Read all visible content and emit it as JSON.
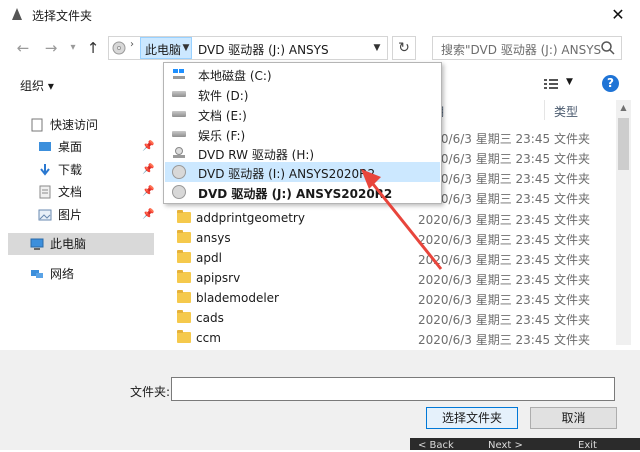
{
  "window": {
    "title": "选择文件夹"
  },
  "address": {
    "crumb": "此电脑",
    "path": "DVD 驱动器 (J:) ANSYS"
  },
  "search": {
    "placeholder": "搜索\"DVD 驱动器 (J:) ANSYS"
  },
  "toolbar": {
    "organize": "组织 ▾"
  },
  "nav": {
    "items": [
      {
        "label": "快速访问",
        "icon": "star-icon"
      },
      {
        "label": "桌面",
        "icon": "desktop-icon",
        "pinned": true
      },
      {
        "label": "下载",
        "icon": "download-icon",
        "pinned": true
      },
      {
        "label": "文档",
        "icon": "document-icon",
        "pinned": true
      },
      {
        "label": "图片",
        "icon": "pictures-icon",
        "pinned": true
      },
      {
        "label": "此电脑",
        "icon": "computer-icon",
        "selected": true
      },
      {
        "label": "网络",
        "icon": "network-icon"
      }
    ]
  },
  "columns": {
    "date": "日期",
    "type": "类型"
  },
  "rows": [
    {
      "name": "",
      "date": "2020/6/3 星期三 23:45",
      "type": "文件夹"
    },
    {
      "name": "",
      "date": "2020/6/3 星期三 23:45",
      "type": "文件夹"
    },
    {
      "name": "",
      "date": "2020/6/3 星期三 23:45",
      "type": "文件夹"
    },
    {
      "name": "",
      "date": "2020/6/3 星期三 23:45",
      "type": "文件夹"
    },
    {
      "name": "addprintgeometry",
      "date": "2020/6/3 星期三 23:45",
      "type": "文件夹"
    },
    {
      "name": "ansys",
      "date": "2020/6/3 星期三 23:45",
      "type": "文件夹"
    },
    {
      "name": "apdl",
      "date": "2020/6/3 星期三 23:45",
      "type": "文件夹"
    },
    {
      "name": "apipsrv",
      "date": "2020/6/3 星期三 23:45",
      "type": "文件夹"
    },
    {
      "name": "blademodeler",
      "date": "2020/6/3 星期三 23:45",
      "type": "文件夹"
    },
    {
      "name": "cads",
      "date": "2020/6/3 星期三 23:45",
      "type": "文件夹"
    },
    {
      "name": "ccm",
      "date": "2020/6/3 星期三 23:45",
      "type": "文件夹"
    }
  ],
  "dropdown": {
    "items": [
      {
        "label": "本地磁盘 (C:)",
        "icon": "windows-drive-icon"
      },
      {
        "label": "软件 (D:)",
        "icon": "drive-icon"
      },
      {
        "label": "文档 (E:)",
        "icon": "drive-icon"
      },
      {
        "label": "娱乐 (F:)",
        "icon": "drive-icon"
      },
      {
        "label": "DVD RW 驱动器 (H:)",
        "icon": "dvd-drive-icon"
      },
      {
        "label": "DVD 驱动器 (I:) ANSYS2020R2",
        "icon": "disc-icon",
        "selected": true
      },
      {
        "label": "DVD 驱动器 (J:) ANSYS2020R2",
        "icon": "disc-icon",
        "bold": true
      }
    ]
  },
  "footer": {
    "folder_label": "文件夹:",
    "folder_value": "",
    "select": "选择文件夹",
    "cancel": "取消"
  },
  "background": {
    "back": "< Back",
    "next": "Next >",
    "exit": "Exit"
  },
  "colors": {
    "accent": "#0078d7",
    "selection": "#cce8ff",
    "arrow": "#e8453c",
    "folder": "#f5c94c"
  }
}
